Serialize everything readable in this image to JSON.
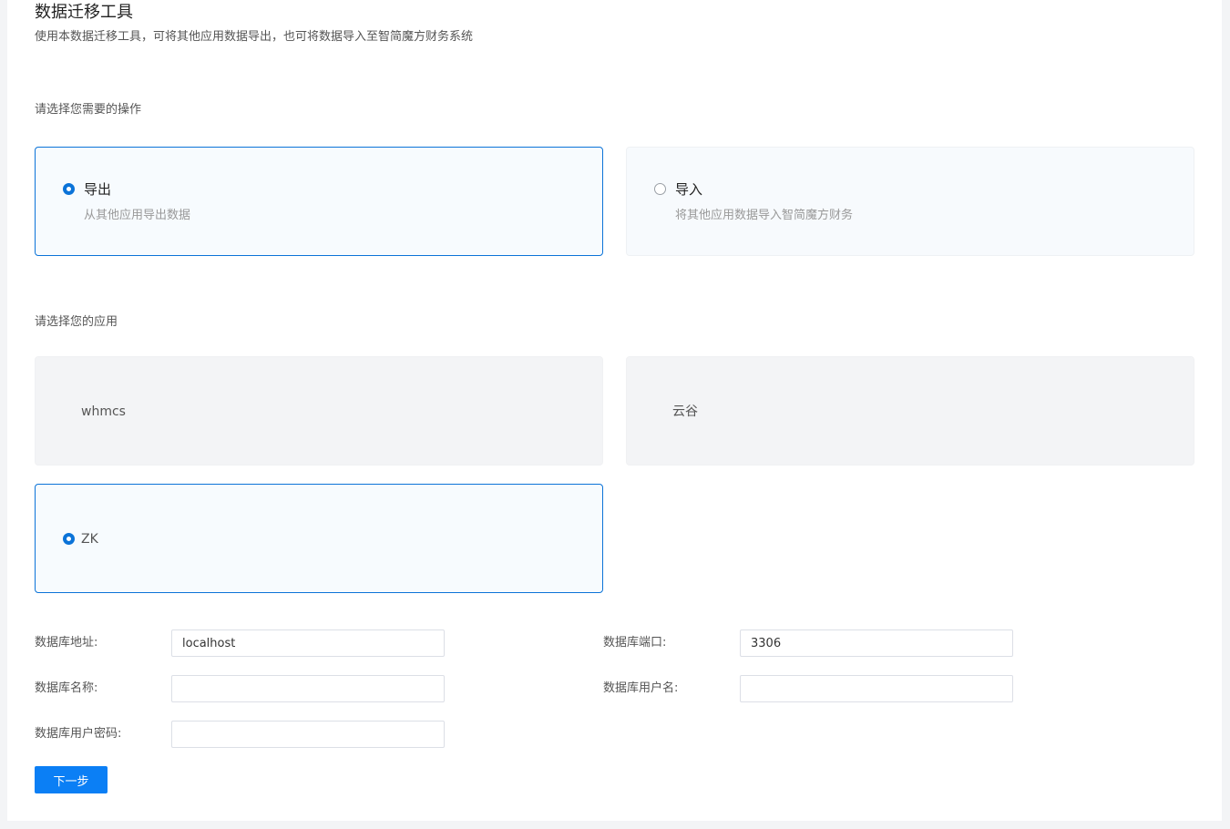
{
  "header": {
    "title": "数据迁移工具",
    "subtitle": "使用本数据迁移工具，可将其他应用数据导出，也可将数据导入至智简魔方财务系统"
  },
  "operation": {
    "label": "请选择您需要的操作",
    "options": [
      {
        "title": "导出",
        "desc": "从其他应用导出数据",
        "selected": true
      },
      {
        "title": "导入",
        "desc": "将其他应用数据导入智简魔方财务",
        "selected": false
      }
    ]
  },
  "application": {
    "label": "请选择您的应用",
    "options": [
      {
        "name": "whmcs",
        "selected": false
      },
      {
        "name": "云谷",
        "selected": false
      },
      {
        "name": "ZK",
        "selected": true
      }
    ]
  },
  "form": {
    "db_host": {
      "label": "数据库地址:",
      "value": "localhost",
      "placeholder": ""
    },
    "db_port": {
      "label": "数据库端口:",
      "value": "3306",
      "placeholder": ""
    },
    "db_name": {
      "label": "数据库名称:",
      "value": "",
      "placeholder": ""
    },
    "db_user": {
      "label": "数据库用户名:",
      "value": "",
      "placeholder": ""
    },
    "db_password": {
      "label": "数据库用户密码:",
      "value": "",
      "placeholder": ""
    }
  },
  "actions": {
    "next_label": "下一步"
  },
  "colors": {
    "accent": "#0b73d8",
    "button": "#0b7ff5",
    "background": "#f3f4f6"
  }
}
